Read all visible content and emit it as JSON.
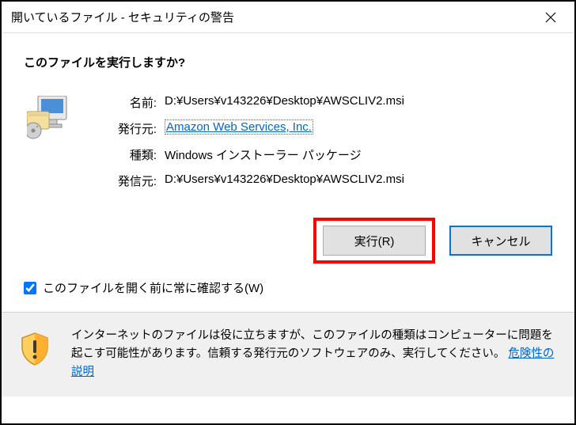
{
  "titlebar": {
    "title": "開いているファイル - セキュリティの警告"
  },
  "question": "このファイルを実行しますか?",
  "details": {
    "name_label": "名前:",
    "name_value": "D:¥Users¥v143226¥Desktop¥AWSCLIV2.msi",
    "publisher_label": "発行元:",
    "publisher_value": "Amazon Web Services, Inc.",
    "type_label": "種類:",
    "type_value": "Windows インストーラー パッケージ",
    "source_label": "発信元:",
    "source_value": "D:¥Users¥v143226¥Desktop¥AWSCLIV2.msi"
  },
  "buttons": {
    "run": "実行(R)",
    "cancel": "キャンセル"
  },
  "checkbox": {
    "label": "このファイルを開く前に常に確認する(W)"
  },
  "warning": {
    "text_1": "インターネットのファイルは役に立ちますが、このファイルの種類はコンピューターに問題を起こす可能性があります。信頼する発行元のソフトウェアのみ、実行してください。",
    "link": "危険性の説明"
  }
}
